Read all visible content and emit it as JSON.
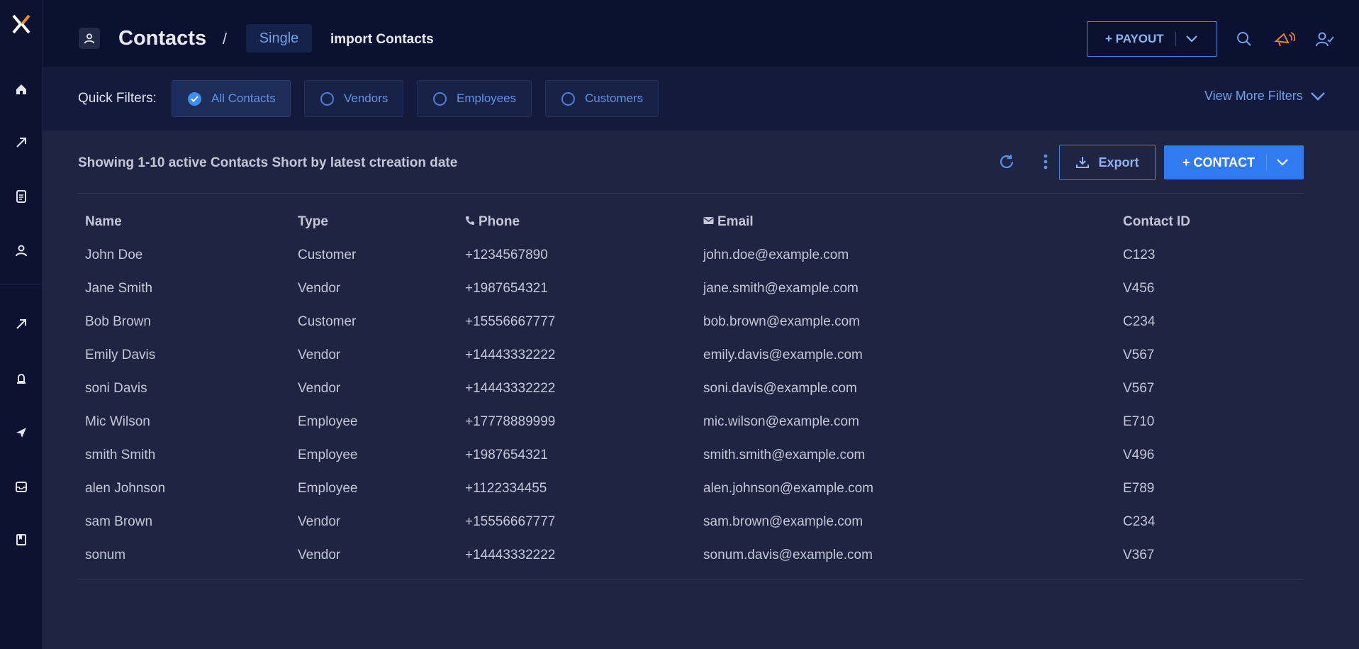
{
  "header": {
    "title": "Contacts",
    "separator": "/",
    "crumb_single": "Single",
    "crumb_import": "import Contacts",
    "payout_label": "+ PAYOUT"
  },
  "filters": {
    "label": "Quick Filters:",
    "chips": [
      {
        "label": "All Contacts",
        "checked": true
      },
      {
        "label": "Vendors",
        "checked": false
      },
      {
        "label": "Employees",
        "checked": false
      },
      {
        "label": "Customers",
        "checked": false
      }
    ],
    "view_more": "View More Filters"
  },
  "toolbar": {
    "showing_text": "Showing 1-10 active Contacts Short by latest ctreation date",
    "export_label": "Export",
    "contact_label": "+ CONTACT"
  },
  "table": {
    "columns": [
      "Name",
      "Type",
      "Phone",
      "Email",
      "Contact ID"
    ],
    "rows": [
      [
        "John Doe",
        "Customer",
        "+1234567890",
        "john.doe@example.com",
        "C123"
      ],
      [
        "Jane Smith",
        "Vendor",
        "+1987654321",
        "jane.smith@example.com",
        "V456"
      ],
      [
        "Bob Brown",
        "Customer",
        "+15556667777",
        "bob.brown@example.com",
        "C234"
      ],
      [
        "Emily Davis",
        "Vendor",
        "+14443332222",
        "emily.davis@example.com",
        "V567"
      ],
      [
        "soni Davis",
        "Vendor",
        "+14443332222",
        "soni.davis@example.com",
        "V567"
      ],
      [
        "Mic Wilson",
        "Employee",
        "+17778889999",
        "mic.wilson@example.com",
        "E710"
      ],
      [
        "smith Smith",
        "Employee",
        "+1987654321",
        "smith.smith@example.com",
        "V496"
      ],
      [
        "alen Johnson",
        "Employee",
        "+1122334455",
        "alen.johnson@example.com",
        "E789"
      ],
      [
        "sam Brown",
        "Vendor",
        "+15556667777",
        "sam.brown@example.com",
        "C234"
      ],
      [
        "sonum",
        "Vendor",
        "+14443332222",
        "sonum.davis@example.com",
        "V367"
      ]
    ]
  },
  "sidebar": {
    "icons": [
      "home-icon",
      "arrow-up-right-icon",
      "document-icon",
      "user-icon",
      "arrow-up-right-icon",
      "bell-icon",
      "send-icon",
      "inbox-icon",
      "book-icon"
    ]
  },
  "colors": {
    "background": "#1e2442",
    "header": "#0b1130",
    "sidebar": "#0c1230",
    "accent": "#2f7bef",
    "link": "#5b93ec",
    "notification": "#e08a1e"
  }
}
